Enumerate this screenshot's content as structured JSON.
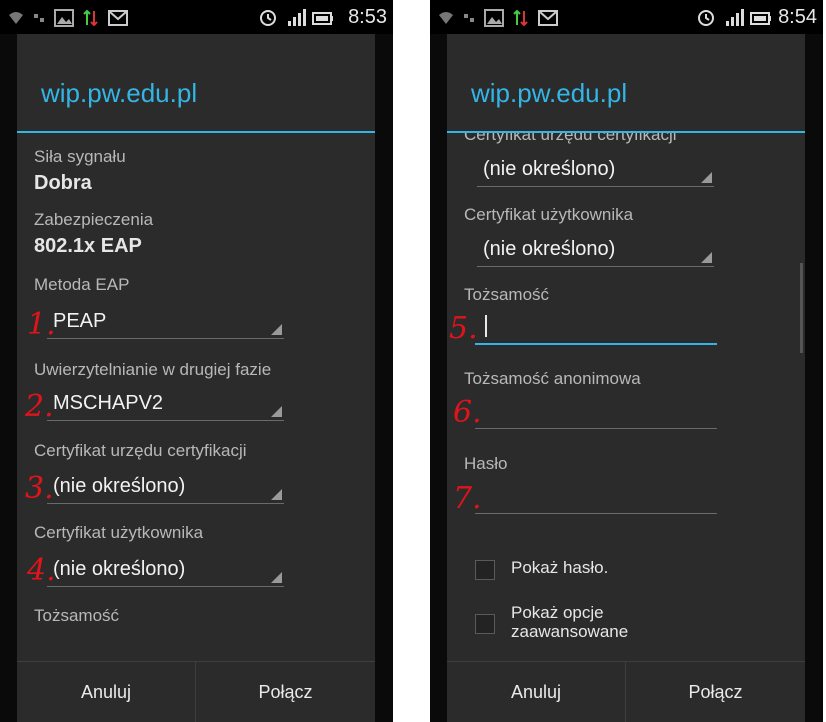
{
  "left": {
    "status": {
      "time": "8:53",
      "icons": [
        "wifi-icon",
        "sync-icon",
        "image-icon",
        "transfer-icon",
        "gmail-icon",
        "alarm-icon",
        "signal-icon",
        "battery-icon"
      ]
    },
    "dialog": {
      "title": "wip.pw.edu.pl",
      "signal_label": "Siła sygnału",
      "signal_value": "Dobra",
      "security_label": "Zabezpieczenia",
      "security_value": "802.1x EAP",
      "eap_label": "Metoda EAP",
      "eap_value": "PEAP",
      "phase2_label": "Uwierzytelnianie w drugiej fazie",
      "phase2_value": "MSCHAPV2",
      "ca_label": "Certyfikat urzędu certyfikacji",
      "ca_value": "(nie określono)",
      "user_cert_label": "Certyfikat użytkownika",
      "user_cert_value": "(nie określono)",
      "identity_label": "Tożsamość"
    },
    "annotations": [
      "1.",
      "2.",
      "3.",
      "4."
    ],
    "buttons": {
      "cancel": "Anuluj",
      "connect": "Połącz"
    }
  },
  "right": {
    "status": {
      "time": "8:54"
    },
    "dialog": {
      "title": "wip.pw.edu.pl",
      "ca_label_partial": "Certyfikat urzędu certyfikacji",
      "ca_value": "(nie określono)",
      "user_cert_label": "Certyfikat użytkownika",
      "user_cert_value": "(nie określono)",
      "identity_label": "Tożsamość",
      "identity_value": "",
      "anon_identity_label": "Tożsamość anonimowa",
      "anon_identity_value": "",
      "password_label": "Hasło",
      "password_value": "",
      "show_password_label": "Pokaż hasło.",
      "show_advanced_label": "Pokaż opcje zaawansowane"
    },
    "annotations": [
      "5.",
      "6.",
      "7."
    ],
    "buttons": {
      "cancel": "Anuluj",
      "connect": "Połącz"
    }
  },
  "colors": {
    "accent": "#33b5e5",
    "annotation": "#e1141b",
    "dialog_bg": "#2b2b2b"
  }
}
